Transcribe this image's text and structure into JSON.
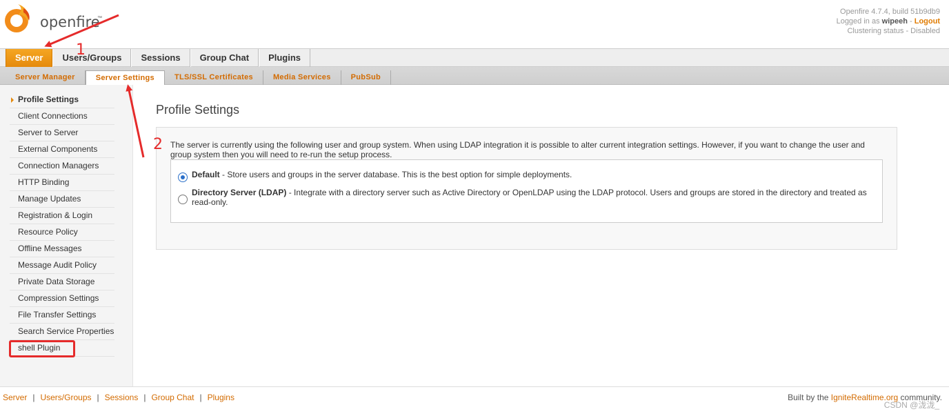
{
  "header": {
    "logo_text": "openfire",
    "version_line": "Openfire 4.7.4, build 51b9db9",
    "logged_in_prefix": "Logged in as",
    "username": "wipeeh",
    "separator": "-",
    "logout_label": "Logout",
    "clustering_status": "Clustering status - Disabled"
  },
  "main_tabs": [
    "Server",
    "Users/Groups",
    "Sessions",
    "Group Chat",
    "Plugins"
  ],
  "sub_tabs": [
    "Server Manager",
    "Server Settings",
    "TLS/SSL Certificates",
    "Media Services",
    "PubSub"
  ],
  "sidebar": {
    "items": [
      "Profile Settings",
      "Client Connections",
      "Server to Server",
      "External Components",
      "Connection Managers",
      "HTTP Binding",
      "Manage Updates",
      "Registration & Login",
      "Resource Policy",
      "Offline Messages",
      "Message Audit Policy",
      "Private Data Storage",
      "Compression Settings",
      "File Transfer Settings",
      "Search Service Properties",
      "shell Plugin"
    ]
  },
  "main": {
    "title": "Profile Settings",
    "description": "The server is currently using the following user and group system. When using LDAP integration it is possible to alter current integration settings. However, if you want to change the user and group system then you will need to re-run the setup process.",
    "options": [
      {
        "label": "Default",
        "text": " - Store users and groups in the server database. This is the best option for simple deployments.",
        "selected": true
      },
      {
        "label": "Directory Server (LDAP)",
        "text": " - Integrate with a directory server such as Active Directory or OpenLDAP using the LDAP protocol. Users and groups are stored in the directory and treated as read-only.",
        "selected": false
      }
    ]
  },
  "footer": {
    "links": [
      "Server",
      "Users/Groups",
      "Sessions",
      "Group Chat",
      "Plugins"
    ],
    "separator": "|",
    "credit_prefix": "Built by the",
    "credit_link": "IgniteRealtime.org",
    "credit_suffix": "community.",
    "watermark": "CSDN @泷泷_"
  },
  "annotations": {
    "label_1": "1",
    "label_2": "2",
    "color": "#e52b2b"
  },
  "colors": {
    "accent": "#e58a0c",
    "link": "#d36b00"
  }
}
